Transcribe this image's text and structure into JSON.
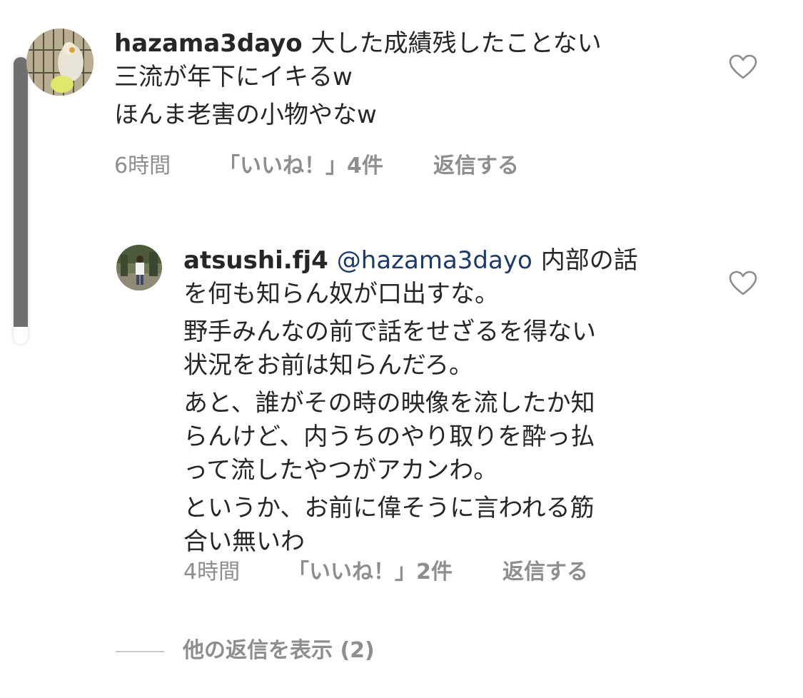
{
  "comment": {
    "username": "hazama3dayo",
    "lines": [
      "大した成績残したことない",
      "三流が年下にイキるw",
      "ほんま老害の小物やなw"
    ],
    "time": "6時間",
    "likes": "「いいね！」4件",
    "reply_label": "返信する"
  },
  "reply": {
    "username": "atsushi.fj4",
    "mention": "@hazama3dayo",
    "lines": [
      "内部の話",
      "を何も知らん奴が口出すな。",
      "野手みんなの前で話をせざるを得ない",
      "状況をお前は知らんだろ。",
      "あと、誰がその時の映像を流したか知",
      "らんけど、内うちのやり取りを酔っ払",
      "って流したやつがアカンわ。",
      "というか、お前に偉そうに言われる筋",
      "合い無いわ"
    ],
    "time": "4時間",
    "likes": "「いいね！」2件",
    "reply_label": "返信する"
  },
  "more_replies_label": "他の返信を表示 (2)",
  "icons": {
    "like": "heart-outline-icon"
  },
  "colors": {
    "text": "#262626",
    "meta": "#8e8e8e",
    "mention": "#1c3a6b"
  }
}
